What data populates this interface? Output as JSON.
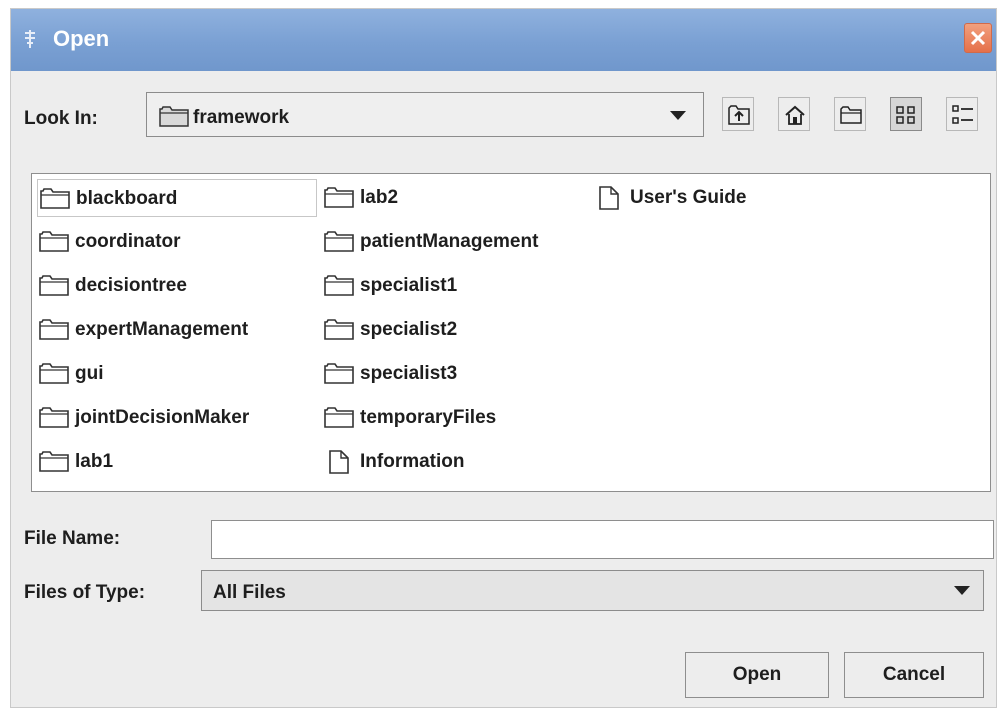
{
  "window": {
    "title": "Open"
  },
  "toolbar": {
    "look_in_label": "Look In:",
    "look_in_value": "framework",
    "buttons": [
      "up-one-level",
      "home",
      "new-folder",
      "list-view",
      "details-view"
    ]
  },
  "files": {
    "col1": [
      {
        "name": "blackboard",
        "type": "folder"
      },
      {
        "name": "coordinator",
        "type": "folder"
      },
      {
        "name": "decisiontree",
        "type": "folder"
      },
      {
        "name": "expertManagement",
        "type": "folder"
      },
      {
        "name": "gui",
        "type": "folder"
      },
      {
        "name": "jointDecisionMaker",
        "type": "folder"
      },
      {
        "name": "lab1",
        "type": "folder"
      }
    ],
    "col2": [
      {
        "name": "lab2",
        "type": "folder"
      },
      {
        "name": "patientManagement",
        "type": "folder"
      },
      {
        "name": "specialist1",
        "type": "folder"
      },
      {
        "name": "specialist2",
        "type": "folder"
      },
      {
        "name": "specialist3",
        "type": "folder"
      },
      {
        "name": "temporaryFiles",
        "type": "folder"
      },
      {
        "name": "Information",
        "type": "file"
      }
    ],
    "col3": [
      {
        "name": "User's Guide",
        "type": "file"
      }
    ]
  },
  "form": {
    "file_name_label": "File Name:",
    "file_name_value": "",
    "files_of_type_label": "Files of Type:",
    "files_of_type_value": "All Files"
  },
  "buttons": {
    "open": "Open",
    "cancel": "Cancel"
  },
  "colors": {
    "titlebar": "#7aa0d3",
    "close": "#e5704a",
    "background": "#ededed"
  }
}
